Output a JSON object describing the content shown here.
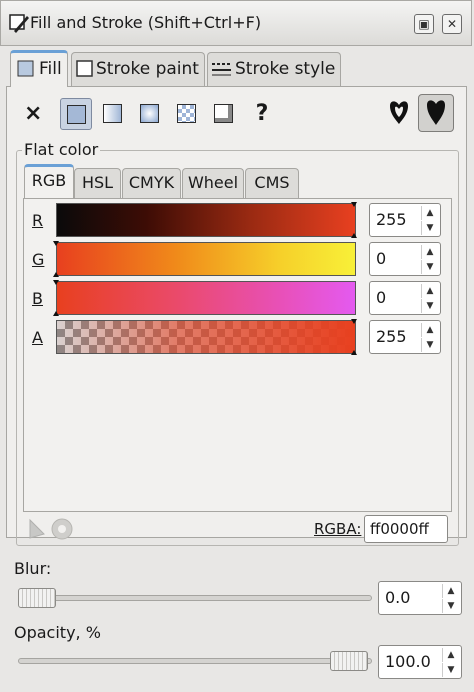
{
  "window": {
    "title": "Fill and Stroke (Shift+Ctrl+F)",
    "buttons": {
      "iconify": "▣",
      "close": "✕"
    }
  },
  "tabs": [
    {
      "label": "Fill",
      "active": true,
      "icon": "fill-icon"
    },
    {
      "label": "Stroke paint",
      "active": false,
      "icon": "stroke-paint-icon"
    },
    {
      "label": "Stroke style",
      "active": false,
      "icon": "stroke-style-icon"
    }
  ],
  "paint_modes": {
    "none": "×",
    "unset": "?",
    "items": [
      "flat-color",
      "linear-gradient",
      "radial-gradient",
      "pattern",
      "swatch",
      "unset"
    ],
    "selected": "flat-color",
    "fill_rules": [
      "evenodd",
      "nonzero"
    ]
  },
  "flat_color": {
    "frame_label": "Flat color",
    "model_tabs": [
      "RGB",
      "HSL",
      "CMYK",
      "Wheel",
      "CMS"
    ],
    "active_model": "RGB",
    "channels": [
      {
        "label": "R",
        "value": "255",
        "level": 255,
        "gradient": [
          "#000000",
          "#ff0000"
        ]
      },
      {
        "label": "G",
        "value": "0",
        "level": 0,
        "gradient": [
          "#ff0000",
          "#ffff00"
        ]
      },
      {
        "label": "B",
        "value": "0",
        "level": 0,
        "gradient": [
          "#ff0000",
          "#ff00ff"
        ]
      },
      {
        "label": "A",
        "value": "255",
        "level": 255,
        "gradient": [
          "#ff000000",
          "#ff0000"
        ]
      }
    ],
    "rgba_label": "RGBA:",
    "rgba_value": "ff0000ff"
  },
  "blur": {
    "label": "Blur:",
    "value": "0.0",
    "level": 0
  },
  "opacity": {
    "label": "Opacity, %",
    "value": "100.0",
    "level": 100
  },
  "colors": {
    "accent": "#6aa0d6",
    "fill": "#e8401f"
  }
}
